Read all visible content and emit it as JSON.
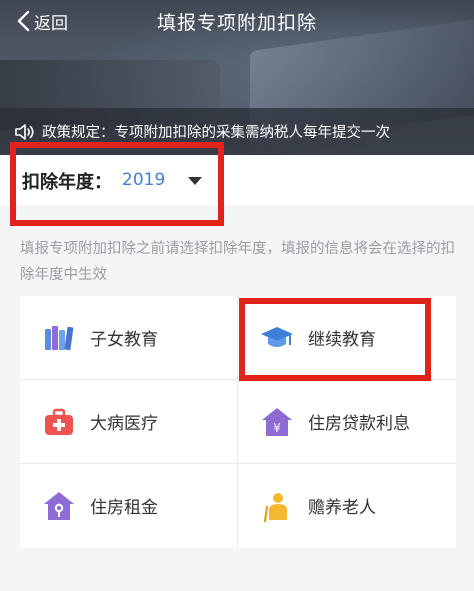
{
  "nav": {
    "back_label": "返回",
    "title": "填报专项附加扣除"
  },
  "notice": {
    "text": "政策规定：专项附加扣除的采集需纳税人每年提交一次",
    "icon": "speaker-icon"
  },
  "year_selector": {
    "label": "扣除年度：",
    "value": "2019",
    "icon": "dropdown-triangle-icon"
  },
  "hint": "填报专项附加扣除之前请选择扣除年度，填报的信息将会在选择的扣除年度中生效",
  "items": [
    {
      "label": "子女教育",
      "icon": "books-icon"
    },
    {
      "label": "继续教育",
      "icon": "graduation-cap-icon"
    },
    {
      "label": "大病医疗",
      "icon": "medical-kit-icon"
    },
    {
      "label": "住房贷款利息",
      "icon": "house-yen-icon"
    },
    {
      "label": "住房租金",
      "icon": "house-key-icon"
    },
    {
      "label": "赡养老人",
      "icon": "elderly-person-icon"
    }
  ],
  "colors": {
    "accent_blue": "#3f7fd6",
    "highlight_red": "#e2231a",
    "icon_red": "#ef5350",
    "icon_purple": "#8f6bd6",
    "icon_gold": "#f5b92e"
  }
}
